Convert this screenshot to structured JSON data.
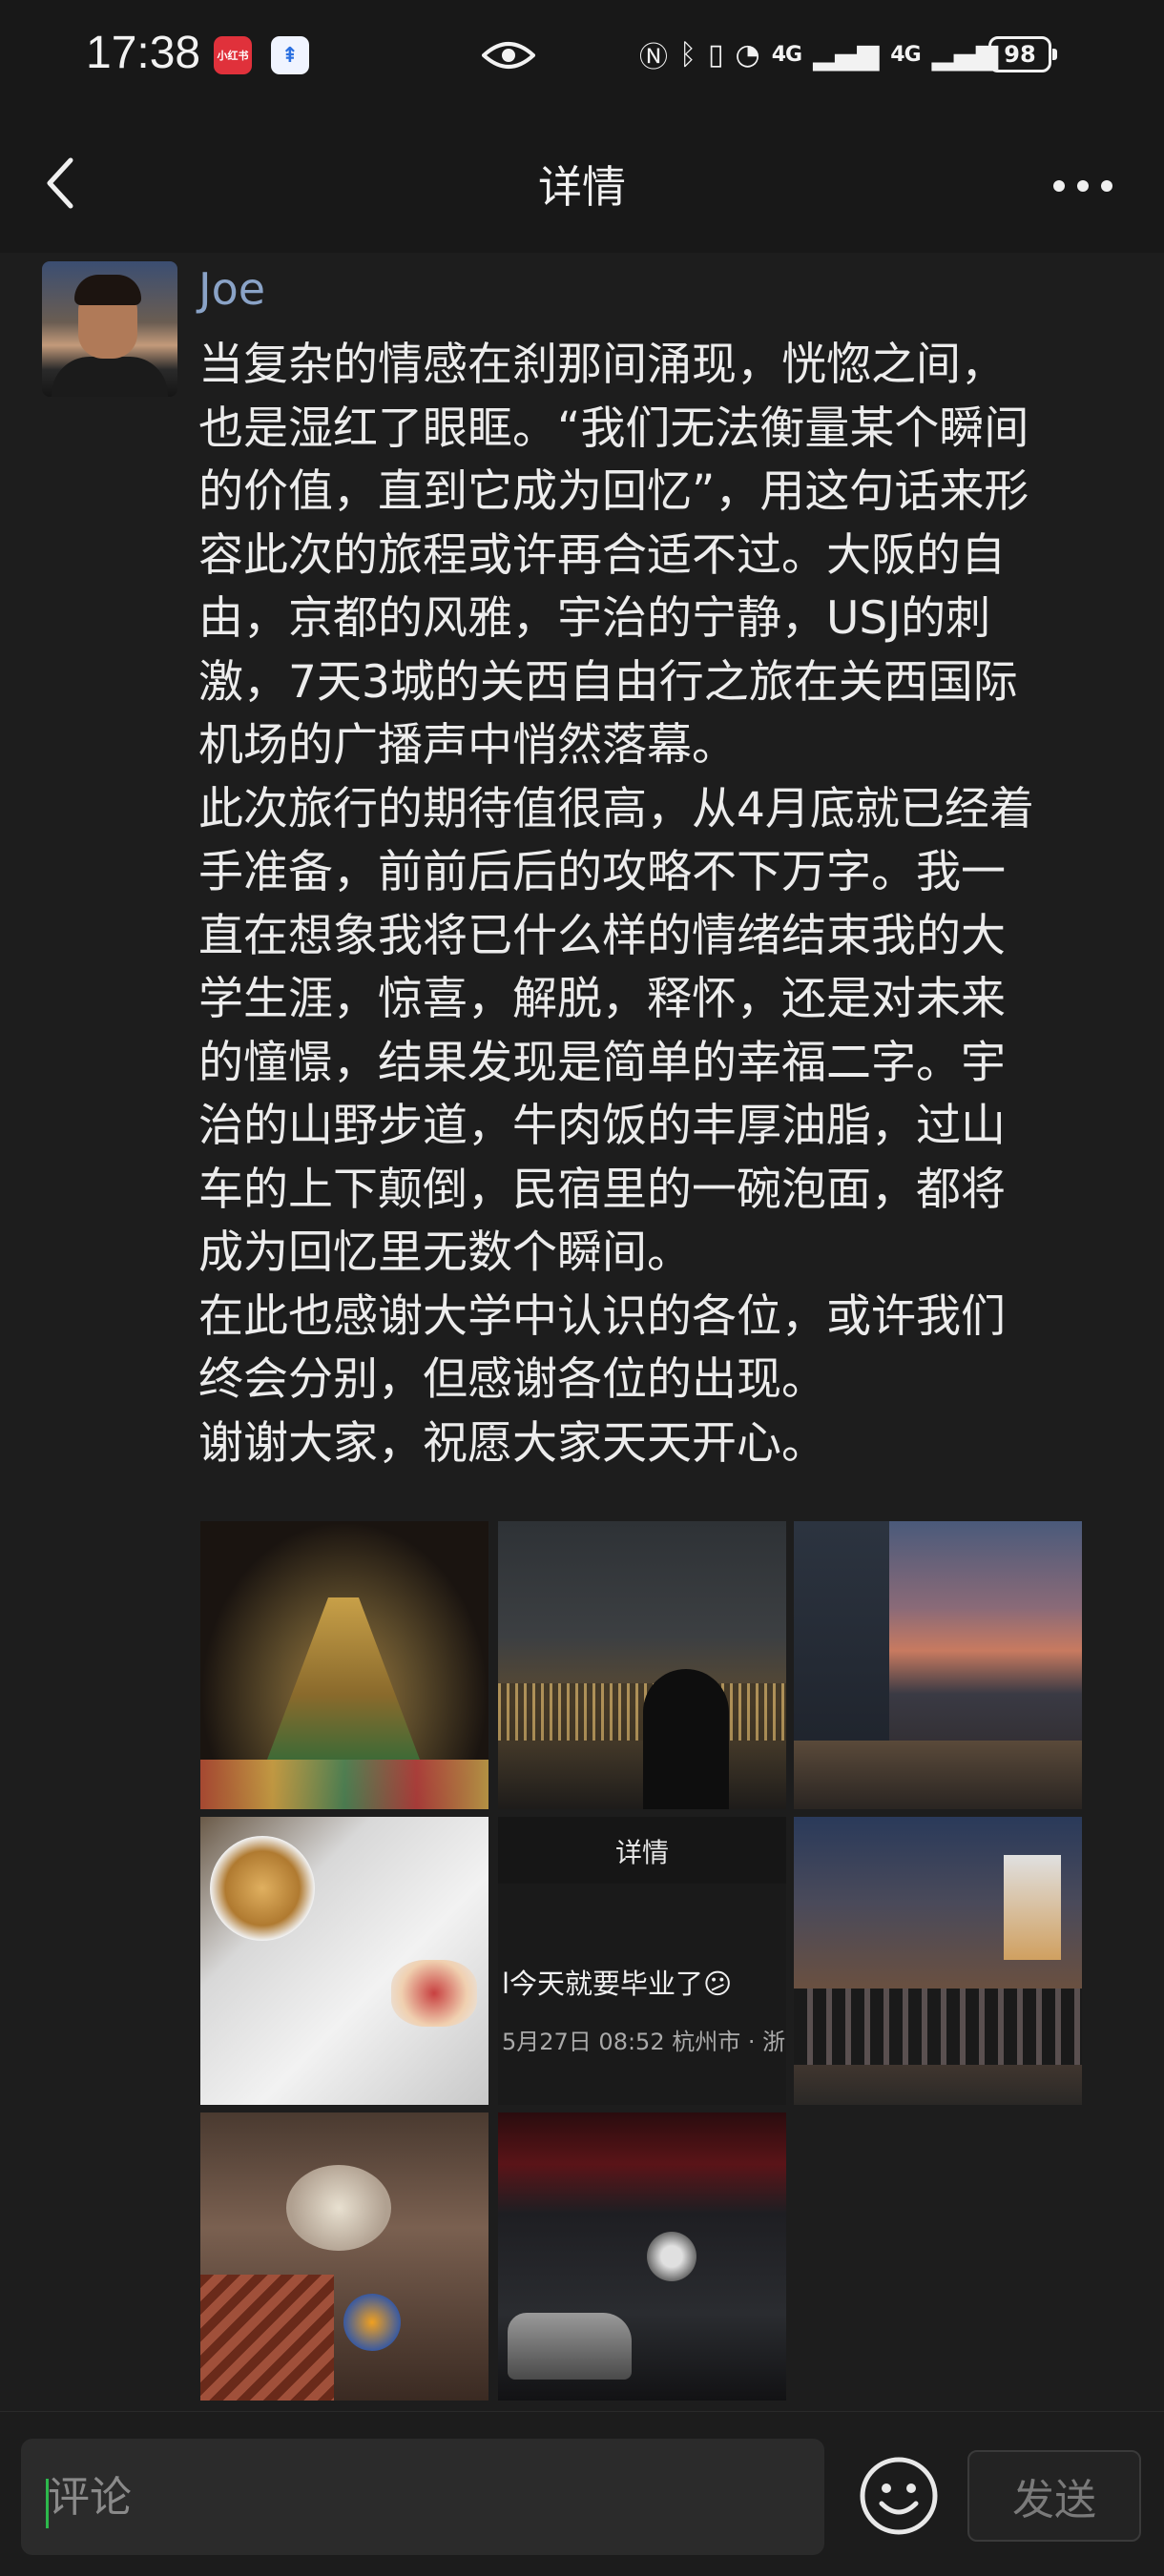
{
  "status_bar": {
    "time": "17:38",
    "app_badge_1": "小红书",
    "app_badge_2": "⇞",
    "network_1": "4G",
    "network_2": "4G",
    "battery": "98"
  },
  "nav": {
    "title": "详情"
  },
  "post": {
    "username": "Joe",
    "content": "当复杂的情感在刹那间涌现，恍惚之间，\n也是湿红了眼眶。“我们无法衡量某个瞬间\n的价值，直到它成为回忆”，用这句话来形\n容此次的旅程或许再合适不过。大阪的自\n由，京都的风雅，宇治的宁静，USJ的刺\n激，7天3城的关西自由行之旅在关西国际\n机场的广播声中悄然落幕。\n此次旅行的期待值很高，从4月底就已经着\n手准备，前前后后的攻略不下万字。我一\n直在想象我将已什么样的情绪结束我的大\n学生涯，惊喜，解脱，释怀，还是对未来\n的憧憬，结果发现是简单的幸福二字。宇\n治的山野步道，牛肉饭的丰厚油脂，过山\n车的上下颠倒，民宿里的一碗泡面，都将\n成为回忆里无数个瞬间。\n在此也感谢大学中认识的各位，或许我们\n终会分别，但感谢各位的出现。\n谢谢大家，祝愿大家天天开心。",
    "screenshot_tile": {
      "header": "详情",
      "text": "l今天就要毕业了😕",
      "meta": "5月27日 08:52  杭州市 · 浙"
    }
  },
  "comment_bar": {
    "placeholder": "评论",
    "send_label": "发送"
  },
  "colors": {
    "background": "#1d1d1d",
    "username": "#8aa3c7",
    "caret": "#2db84c"
  }
}
